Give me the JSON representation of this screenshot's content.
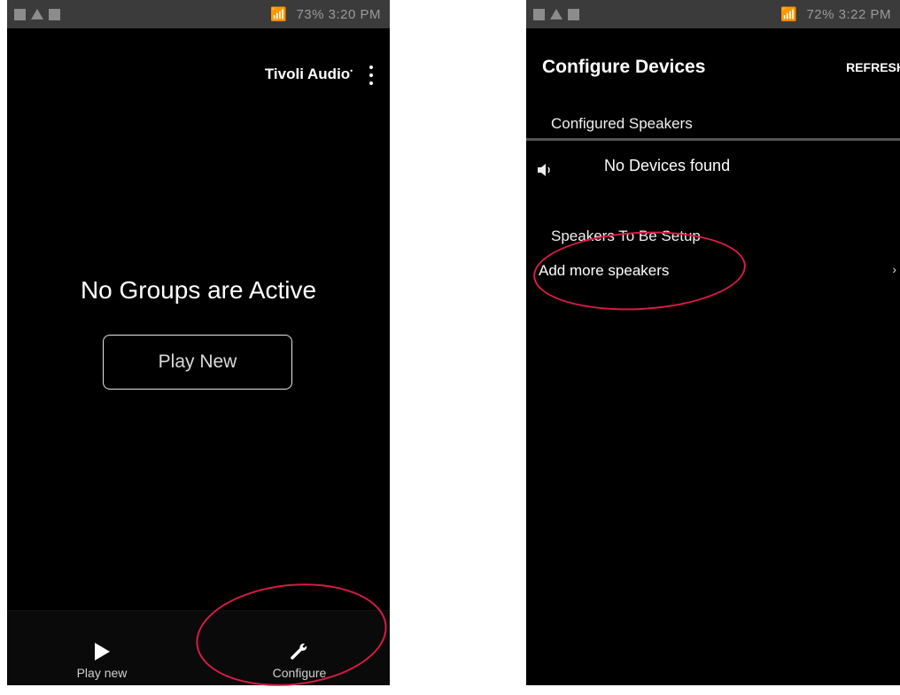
{
  "left_screen": {
    "status_bar": {
      "right_text": "73% 3:20 PM"
    },
    "header": {
      "brand": "Tivoli Audio"
    },
    "message": "No Groups are Active",
    "play_new_button": "Play New",
    "bottom_nav": {
      "play_label": "Play new",
      "configure_label": "Configure",
      "play_icon": "play-icon",
      "configure_icon": "wrench-icon"
    }
  },
  "right_screen": {
    "status_bar": {
      "right_text": "72% 3:22 PM"
    },
    "header": {
      "title": "Configure Devices",
      "action": "REFRESH"
    },
    "configured_section": "Configured Speakers",
    "no_devices": "No Devices found",
    "setup_section": "Speakers To Be Setup",
    "add_more": "Add more speakers",
    "chevron": "›"
  },
  "annotation_color": "#d81b46"
}
